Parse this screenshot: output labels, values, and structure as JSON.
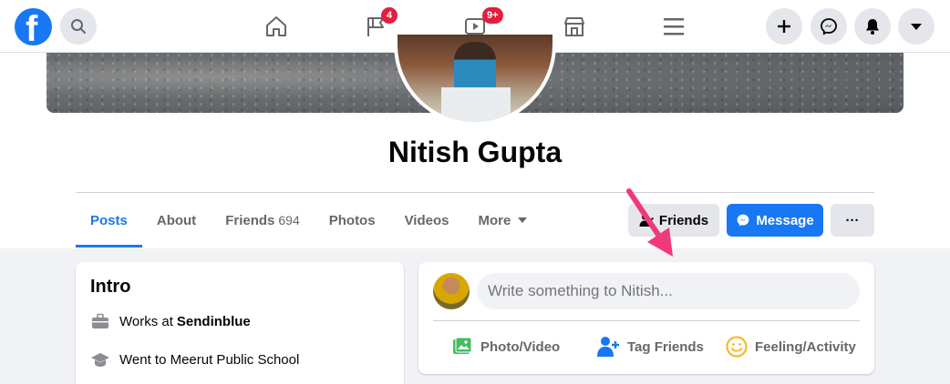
{
  "nav": {
    "logo_letter": "f",
    "watch_badge": "9+",
    "groups_badge": "4",
    "icons": [
      "search-icon",
      "home-icon",
      "pages-flag-icon",
      "watch-icon",
      "marketplace-icon",
      "menu-icon",
      "plus-icon",
      "messenger-icon",
      "notifications-bell-icon",
      "account-caret-icon"
    ]
  },
  "profile": {
    "name": "Nitish Gupta"
  },
  "tabs": [
    {
      "label": "Posts",
      "active": true
    },
    {
      "label": "About"
    },
    {
      "label": "Friends",
      "count": "694"
    },
    {
      "label": "Photos"
    },
    {
      "label": "Videos"
    },
    {
      "label": "More"
    }
  ],
  "actions": {
    "friends_label": "Friends",
    "message_label": "Message",
    "more_label": "···"
  },
  "intro": {
    "title": "Intro",
    "work_prefix": "Works at",
    "work_place": "Sendinblue",
    "education": "Went to Meerut Public School"
  },
  "composer": {
    "placeholder": "Write something to Nitish...",
    "photo_video": "Photo/Video",
    "tag_friends": "Tag Friends",
    "feeling": "Feeling/Activity"
  },
  "colors": {
    "brand_blue": "#1877f2",
    "badge_red": "#e41e3f",
    "annotation_pink": "#f0397a"
  }
}
